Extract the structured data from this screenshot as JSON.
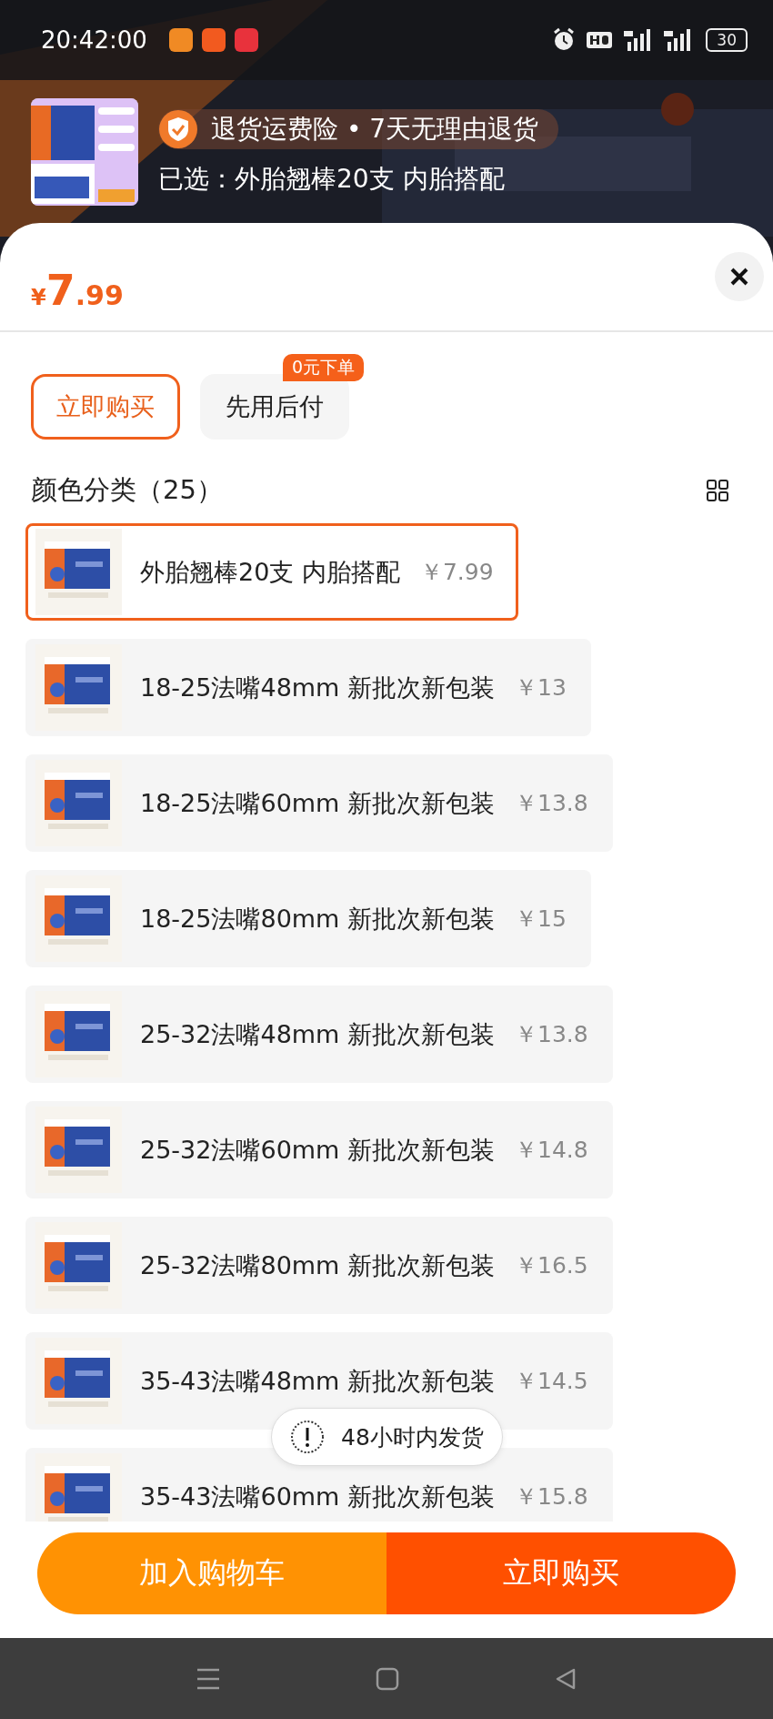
{
  "status_bar": {
    "time": "20:42:00",
    "battery": "30"
  },
  "header": {
    "badge": "退货运费险 • 7天无理由退货",
    "selected": "已选：外胎翘棒20支 内胎搭配"
  },
  "price": {
    "currency": "¥",
    "integer": "7",
    "decimal": ".99"
  },
  "payment_options": [
    {
      "label": "立即购买",
      "selected": true
    },
    {
      "label": "先用后付",
      "selected": false,
      "badge": "0元下单"
    }
  ],
  "section_title": "颜色分类（25）",
  "items": [
    {
      "name": "外胎翘棒20支 内胎搭配",
      "price": "￥7.99",
      "selected": true
    },
    {
      "name": "18-25法嘴48mm 新批次新包装",
      "price": "￥13",
      "selected": false
    },
    {
      "name": "18-25法嘴60mm 新批次新包装",
      "price": "￥13.8",
      "selected": false
    },
    {
      "name": "18-25法嘴80mm 新批次新包装",
      "price": "￥15",
      "selected": false
    },
    {
      "name": "25-32法嘴48mm 新批次新包装",
      "price": "￥13.8",
      "selected": false
    },
    {
      "name": "25-32法嘴60mm 新批次新包装",
      "price": "￥14.8",
      "selected": false
    },
    {
      "name": "25-32法嘴80mm 新批次新包装",
      "price": "￥16.5",
      "selected": false
    },
    {
      "name": "35-43法嘴48mm 新批次新包装",
      "price": "￥14.5",
      "selected": false
    },
    {
      "name": "35-43法嘴60mm 新批次新包装",
      "price": "￥15.8",
      "selected": false
    }
  ],
  "toast": "48小时内发货",
  "actions": [
    {
      "label": "加入购物车",
      "kind": "cart"
    },
    {
      "label": "立即购买",
      "kind": "buy"
    }
  ]
}
